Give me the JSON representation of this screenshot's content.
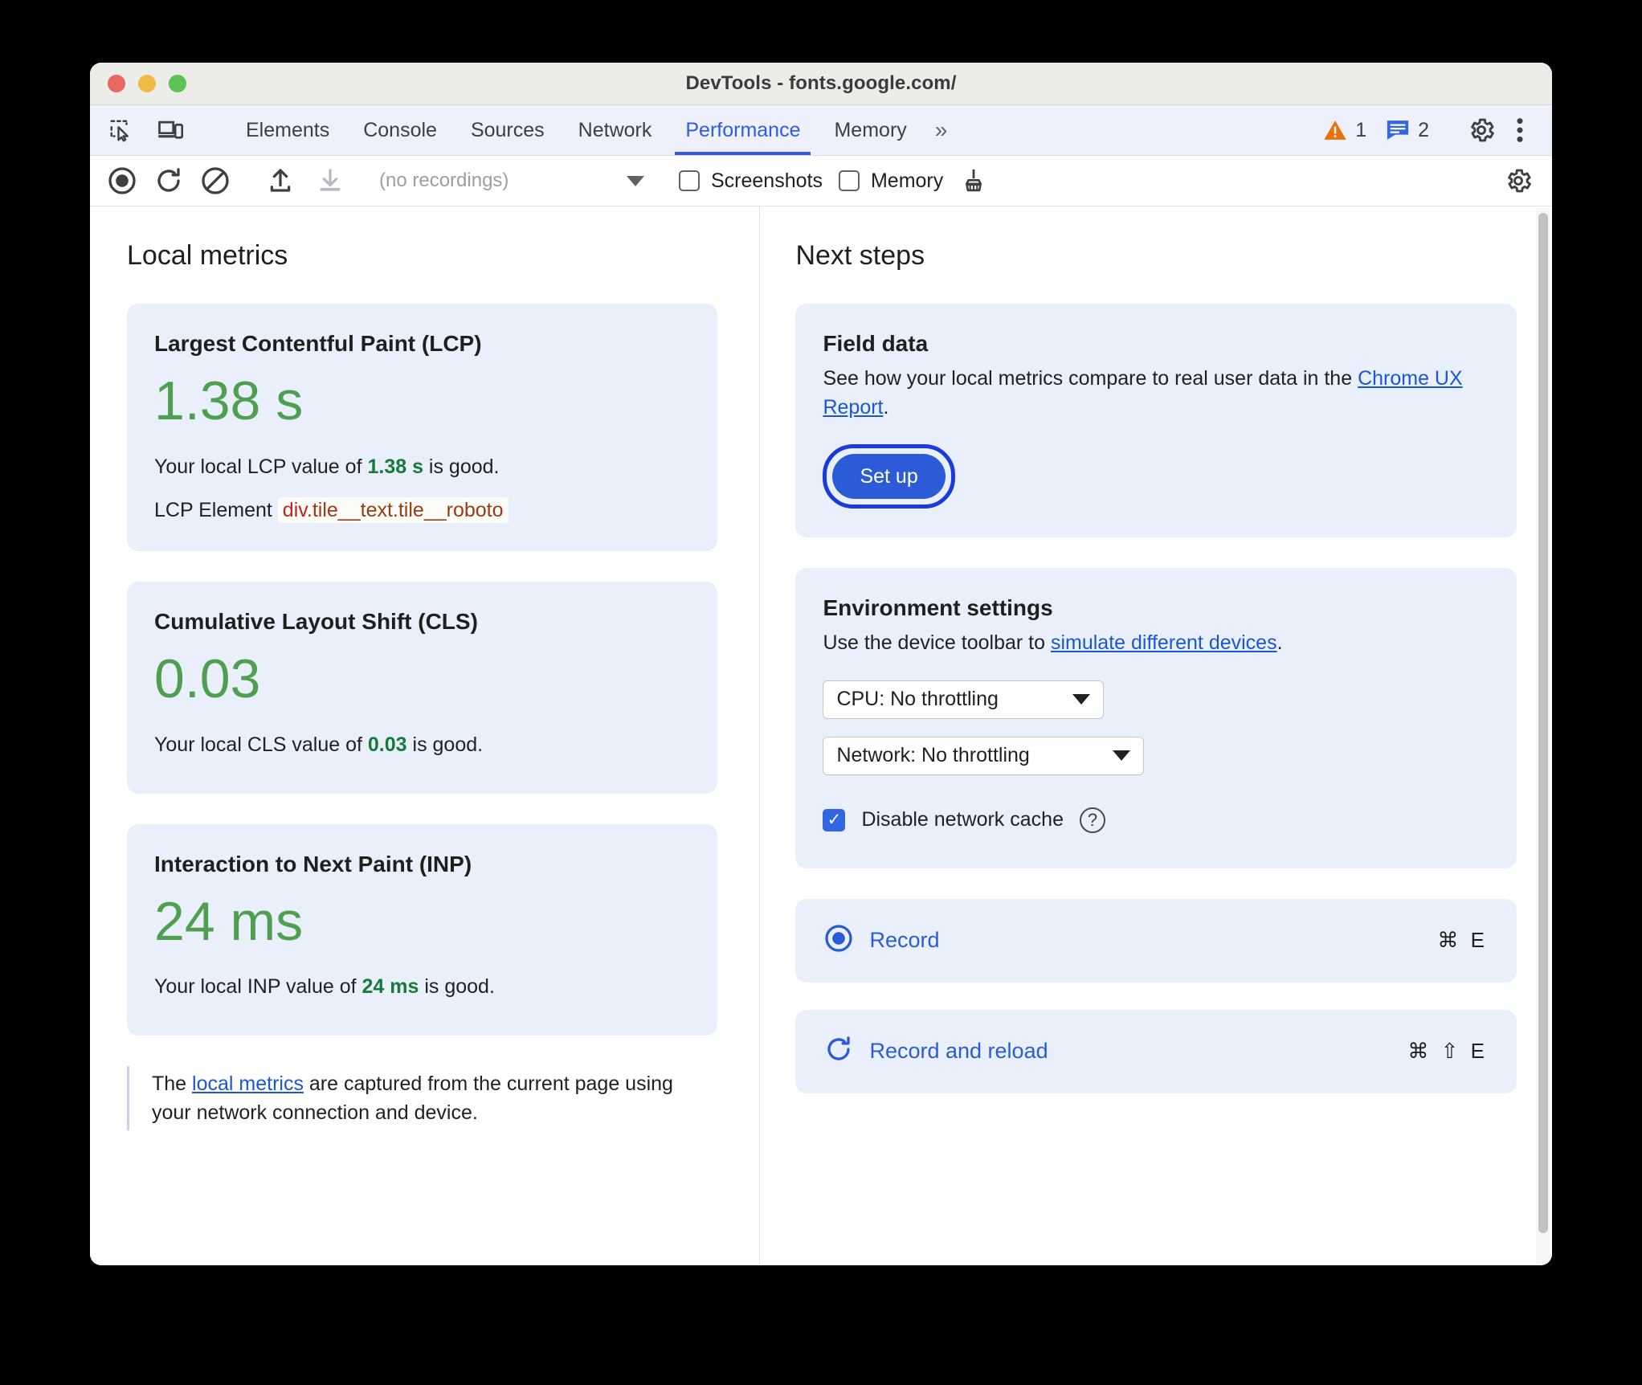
{
  "window": {
    "title": "DevTools - fonts.google.com/",
    "traffic_lights": [
      "close-red",
      "minimize-yellow",
      "maximize-green"
    ]
  },
  "tabbar": {
    "left_icons": [
      {
        "name": "inspect-element-icon",
        "label": "Inspect"
      },
      {
        "name": "device-toolbar-icon",
        "label": "Toggle device toolbar"
      }
    ],
    "tabs": [
      {
        "label": "Elements",
        "active": false
      },
      {
        "label": "Console",
        "active": false
      },
      {
        "label": "Sources",
        "active": false
      },
      {
        "label": "Network",
        "active": false
      },
      {
        "label": "Performance",
        "active": true
      },
      {
        "label": "Memory",
        "active": false
      }
    ],
    "more_tabs_label": "»",
    "warning_count": "1",
    "info_count": "2",
    "settings_icon": "gear-icon",
    "more_options_icon": "three-dots-vertical-icon"
  },
  "perf_toolbar": {
    "record_icon": "record-circle-icon",
    "reload_icon": "record-and-reload-icon",
    "clear_icon": "clear-icon",
    "upload_icon": "upload-profile-icon",
    "download_icon": "download-profile-icon",
    "recordings_value": "(no recordings)",
    "screenshots_label": "Screenshots",
    "screenshots_checked": false,
    "memory_label": "Memory",
    "memory_checked": false,
    "gc_icon": "collect-garbage-broom-icon",
    "settings_icon": "gear-icon"
  },
  "local_metrics": {
    "heading": "Local metrics",
    "cards": [
      {
        "title": "Largest Contentful Paint (LCP)",
        "value": "1.38 s",
        "desc_prefix": "Your local LCP value of ",
        "desc_value": "1.38 s",
        "desc_suffix": " is good.",
        "element_label": "LCP Element",
        "element_tag": "div",
        "element_classes": ".tile__text.tile__roboto"
      },
      {
        "title": "Cumulative Layout Shift (CLS)",
        "value": "0.03",
        "desc_prefix": "Your local CLS value of ",
        "desc_value": "0.03",
        "desc_suffix": " is good."
      },
      {
        "title": "Interaction to Next Paint (INP)",
        "value": "24 ms",
        "desc_prefix": "Your local INP value of ",
        "desc_value": "24 ms",
        "desc_suffix": " is good."
      }
    ],
    "note_prefix": "The ",
    "note_link": "local metrics",
    "note_suffix": " are captured from the current page using your network connection and device."
  },
  "next_steps": {
    "heading": "Next steps",
    "field_data": {
      "title": "Field data",
      "desc_prefix": "See how your local metrics compare to real user data in the ",
      "desc_link": "Chrome UX Report",
      "desc_suffix": ".",
      "setup_button": "Set up"
    },
    "environment": {
      "title": "Environment settings",
      "desc_prefix": "Use the device toolbar to ",
      "desc_link": "simulate different devices",
      "desc_suffix": ".",
      "cpu_select": "CPU: No throttling",
      "network_select": "Network: No throttling",
      "cache_label": "Disable network cache",
      "cache_checked": true,
      "help_icon": "help-question-icon"
    },
    "actions": [
      {
        "icon": "record-circle-icon",
        "label": "Record",
        "shortcut": "⌘ E"
      },
      {
        "icon": "record-and-reload-icon",
        "label": "Record and reload",
        "shortcut": "⌘ ⇧ E"
      }
    ]
  },
  "colors": {
    "accent_blue": "#2f5ce6",
    "link_blue": "#1a56d6",
    "good_green": "#177a3a",
    "metric_green": "#4e9f50",
    "card_bg": "#eaf0fb",
    "warning_orange": "#e8710a",
    "element_tag_red": "#c5221f",
    "element_class_brown": "#9a3b13"
  }
}
